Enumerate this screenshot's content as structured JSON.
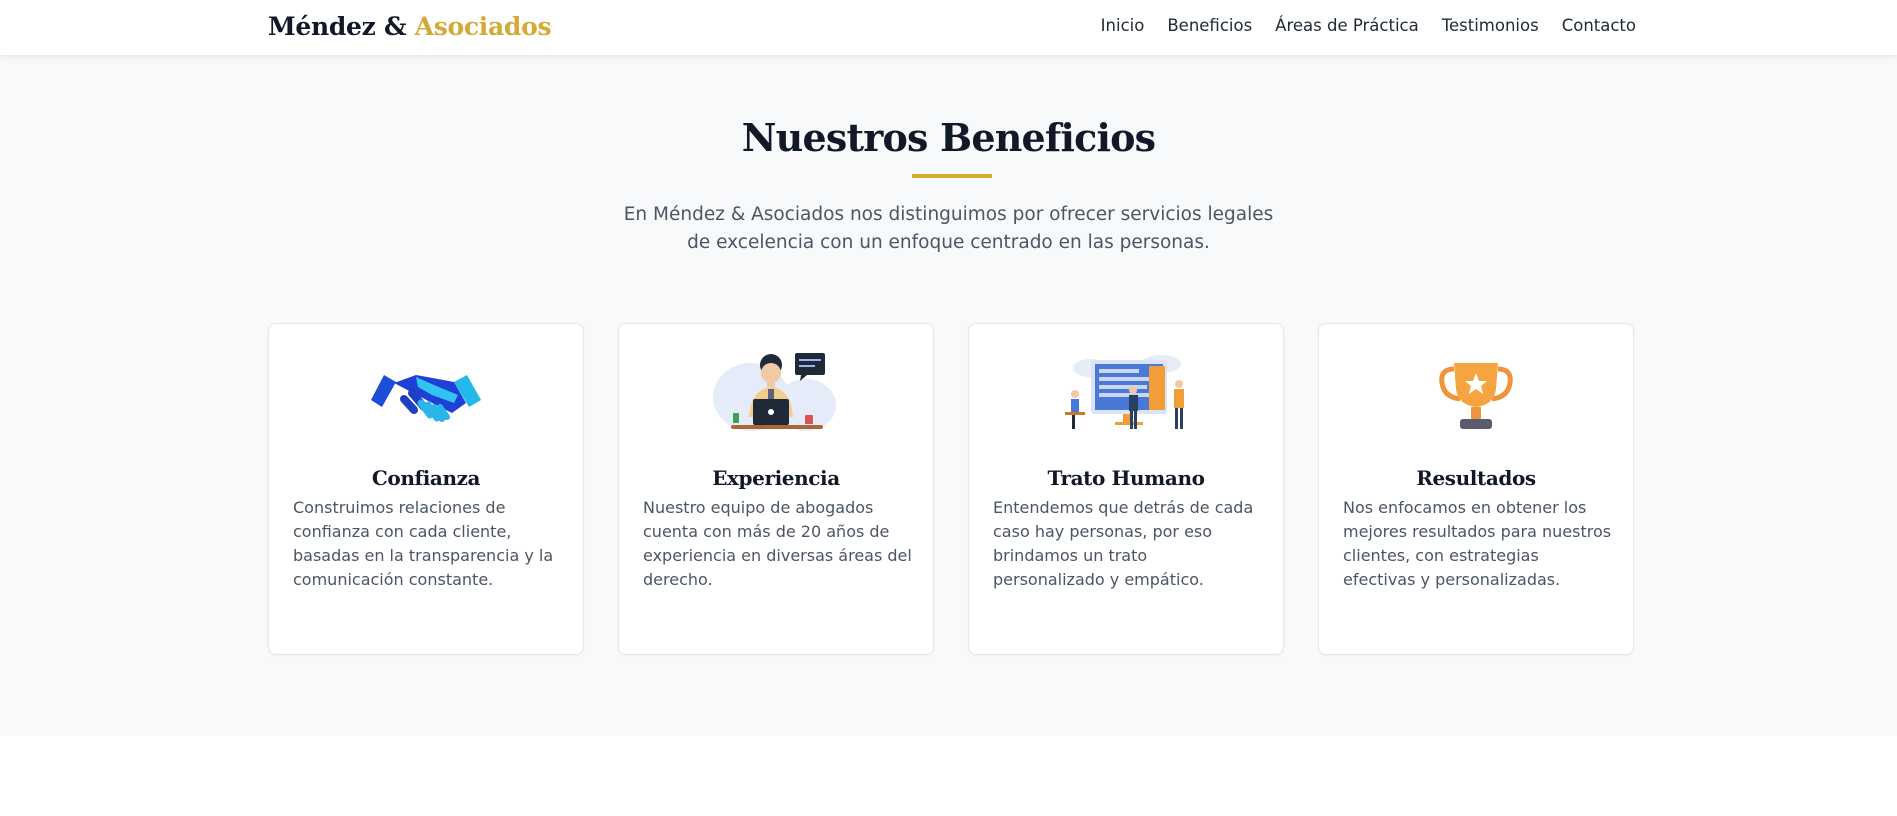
{
  "header": {
    "logo_main": "Méndez &",
    "logo_accent": "Asociados",
    "nav": [
      "Inicio",
      "Beneficios",
      "Áreas de Práctica",
      "Testimonios",
      "Contacto"
    ]
  },
  "benefits": {
    "title": "Nuestros Beneficios",
    "subtitle": "En Méndez & Asociados nos distinguimos por ofrecer servicios legales de excelencia con un enfoque centrado en las personas.",
    "cards": [
      {
        "icon": "handshake-icon",
        "title": "Confianza",
        "description": "Construimos relaciones de confianza con cada cliente, basadas en la transparencia y la comunicación constante."
      },
      {
        "icon": "lawyer-laptop-icon",
        "title": "Experiencia",
        "description": "Nuestro equipo de abogados cuenta con más de 20 años de experiencia en diversas áreas del derecho."
      },
      {
        "icon": "team-meeting-icon",
        "title": "Trato Humano",
        "description": "Entendemos que detrás de cada caso hay personas, por eso brindamos un trato personalizado y empático."
      },
      {
        "icon": "trophy-icon",
        "title": "Resultados",
        "description": "Nos enfocamos en obtener los mejores resultados para nuestros clientes, con estrategias efectivas y personalizadas."
      }
    ]
  },
  "colors": {
    "accent": "#d4a935",
    "section_bg": "#f8f9fb",
    "text_dark": "#111827",
    "text_body": "#4b5563"
  }
}
